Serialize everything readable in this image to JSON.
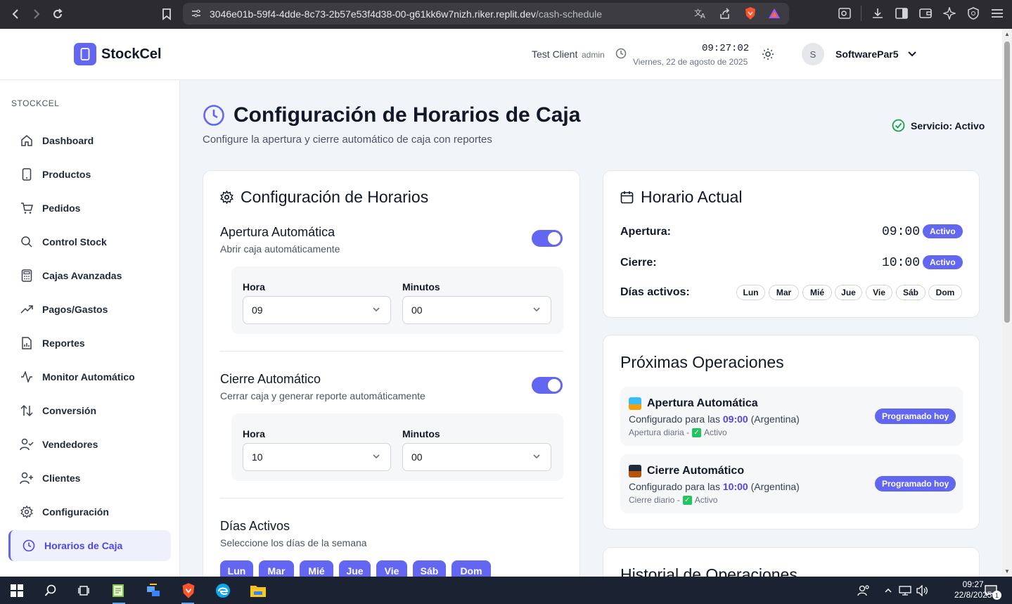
{
  "browser": {
    "url_host": "3046e01b-59f4-4dde-8c73-2b57e53f4d38-00-g61kk6w7nizh.riker.replit.dev",
    "url_path": "/cash-schedule"
  },
  "header": {
    "brand": "StockCel",
    "client_name": "Test Client",
    "client_role": "admin",
    "time": "09:27:02",
    "date": "Viernes, 22 de agosto de 2025",
    "avatar_initial": "S",
    "user_name": "SoftwarePar5"
  },
  "sidebar": {
    "heading": "STOCKCEL",
    "items": [
      {
        "label": "Dashboard",
        "icon": "home-icon"
      },
      {
        "label": "Productos",
        "icon": "phone-icon"
      },
      {
        "label": "Pedidos",
        "icon": "cart-icon"
      },
      {
        "label": "Control Stock",
        "icon": "search-icon"
      },
      {
        "label": "Cajas Avanzadas",
        "icon": "calculator-icon"
      },
      {
        "label": "Pagos/Gastos",
        "icon": "trending-up-icon"
      },
      {
        "label": "Reportes",
        "icon": "report-icon"
      },
      {
        "label": "Monitor Automático",
        "icon": "activity-icon"
      },
      {
        "label": "Conversión",
        "icon": "arrows-up-down-icon"
      },
      {
        "label": "Vendedores",
        "icon": "user-check-icon"
      },
      {
        "label": "Clientes",
        "icon": "user-plus-icon"
      },
      {
        "label": "Configuración",
        "icon": "gear-icon"
      },
      {
        "label": "Horarios de Caja",
        "icon": "clock-icon"
      }
    ]
  },
  "page": {
    "title": "Configuración de Horarios de Caja",
    "subtitle": "Configure la apertura y cierre automático de caja con reportes",
    "service_status": "Servicio: Activo"
  },
  "config": {
    "title": "Configuración de Horarios",
    "opening": {
      "title": "Apertura Automática",
      "subtitle": "Abrir caja automáticamente",
      "enabled": true,
      "hour_label": "Hora",
      "hour": "09",
      "minutes_label": "Minutos",
      "minutes": "00"
    },
    "closing": {
      "title": "Cierre Automático",
      "subtitle": "Cerrar caja y generar reporte automáticamente",
      "enabled": true,
      "hour_label": "Hora",
      "hour": "10",
      "minutes_label": "Minutos",
      "minutes": "00"
    },
    "days": {
      "title": "Días Activos",
      "subtitle": "Seleccione los días de la semana",
      "list": [
        "Lun",
        "Mar",
        "Mié",
        "Jue",
        "Vie",
        "Sáb",
        "Dom"
      ]
    }
  },
  "current": {
    "title": "Horario Actual",
    "opening_label": "Apertura:",
    "opening_time": "09:00",
    "opening_badge": "Activo",
    "closing_label": "Cierre:",
    "closing_time": "10:00",
    "closing_badge": "Activo",
    "days_label": "Días activos:",
    "days": [
      "Lun",
      "Mar",
      "Mié",
      "Jue",
      "Vie",
      "Sáb",
      "Dom"
    ]
  },
  "upcoming": {
    "title": "Próximas Operaciones",
    "ops": [
      {
        "title": "Apertura Automática",
        "desc_prefix": "Configurado para las",
        "time": "09:00",
        "desc_suffix": "(Argentina)",
        "meta_prefix": "Apertura diaria -",
        "meta_status": "Activo",
        "badge": "Programado hoy"
      },
      {
        "title": "Cierre Automático",
        "desc_prefix": "Configurado para las",
        "time": "10:00",
        "desc_suffix": "(Argentina)",
        "meta_prefix": "Cierre diario -",
        "meta_status": "Activo",
        "badge": "Programado hoy"
      }
    ]
  },
  "history": {
    "title": "Historial de Operaciones"
  },
  "taskbar": {
    "time": "09:27",
    "date": "22/8/2025",
    "notifications": "1"
  },
  "colors": {
    "accent": "#6366f1",
    "success": "#16a34a"
  }
}
